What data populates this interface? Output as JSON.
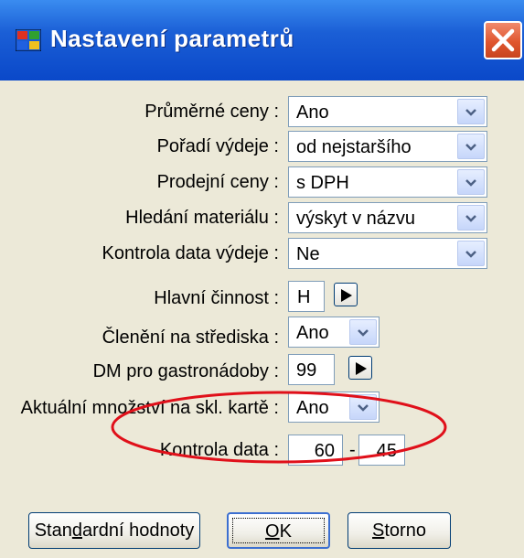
{
  "window": {
    "title": "Nastavení parametrů"
  },
  "fields": [
    {
      "label": "Průměrné ceny :",
      "value": "Ano"
    },
    {
      "label": "Pořadí výdeje :",
      "value": "od nejstaršího"
    },
    {
      "label": "Prodejní ceny :",
      "value": "s DPH"
    },
    {
      "label": "Hledání materiálu :",
      "value": "výskyt v názvu"
    },
    {
      "label": "Kontrola data výdeje :",
      "value": "Ne"
    },
    {
      "label": "Hlavní činnost :",
      "value": "H"
    },
    {
      "label": "Členění na střediska :",
      "value": "Ano"
    },
    {
      "label": "DM pro gastronádoby :",
      "value": "99"
    },
    {
      "label": "Aktuální množství na skl. kartě :",
      "value": "Ano"
    }
  ],
  "kontrola_data": {
    "label": "Kontrola data :",
    "from": "60",
    "separator": "-",
    "to": "45"
  },
  "buttons": {
    "defaults_pre": "Stan",
    "defaults_mnemonic": "d",
    "defaults_post": "ardní hodnoty",
    "ok_mnemonic": "O",
    "ok_post": "K",
    "cancel_mnemonic": "S",
    "cancel_post": "torno"
  },
  "colors": {
    "titlebar": "#0a48c9",
    "face": "#ece9d8",
    "close": "#e0562f",
    "annotation": "#e0101a"
  }
}
